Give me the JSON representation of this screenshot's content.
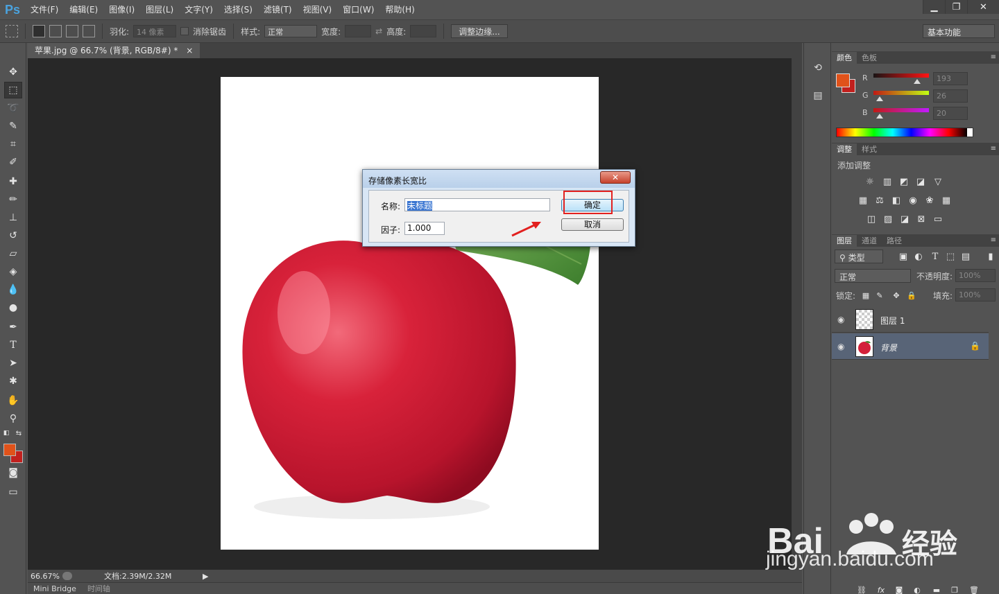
{
  "app": {
    "logo": "Ps"
  },
  "menu": [
    "文件(F)",
    "编辑(E)",
    "图像(I)",
    "图层(L)",
    "文字(Y)",
    "选择(S)",
    "滤镜(T)",
    "视图(V)",
    "窗口(W)",
    "帮助(H)"
  ],
  "options": {
    "feather_label": "羽化:",
    "feather_value": "14 像素",
    "antialias_label": "消除锯齿",
    "style_label": "样式:",
    "style_value": "正常",
    "width_label": "宽度:",
    "height_label": "高度:",
    "refine_edge": "调整边缘...",
    "workspace": "基本功能"
  },
  "document": {
    "tab_title": "苹果.jpg @ 66.7% (背景, RGB/8#) *",
    "zoom": "66.67%",
    "doc_size": "文档:2.39M/2.32M"
  },
  "bottom_tabs": [
    "Mini Bridge",
    "时间轴"
  ],
  "dialog": {
    "title": "存储像素长宽比",
    "name_label": "名称:",
    "name_value": "未标题",
    "factor_label": "因子:",
    "factor_value": "1.000",
    "ok": "确定",
    "cancel": "取消",
    "close_glyph": "✕"
  },
  "color_panel": {
    "tabs": [
      "颜色",
      "色板"
    ],
    "r_label": "R",
    "g_label": "G",
    "b_label": "B",
    "r": "193",
    "g": "26",
    "b": "20",
    "fg_color": "#e0521a",
    "bg_color": "#c1201e"
  },
  "adjust_panel": {
    "tabs": [
      "调整",
      "样式"
    ],
    "title": "添加调整"
  },
  "layers_panel": {
    "tabs": [
      "图层",
      "通道",
      "路径"
    ],
    "filter_label": "类型",
    "blend_mode": "正常",
    "opacity_label": "不透明度:",
    "opacity_value": "100%",
    "lock_label": "锁定:",
    "fill_label": "填充:",
    "fill_value": "100%",
    "layers": [
      {
        "name": "图层 1"
      },
      {
        "name": "背景"
      }
    ]
  },
  "watermark": {
    "text": "jingyan.baidu.com"
  }
}
